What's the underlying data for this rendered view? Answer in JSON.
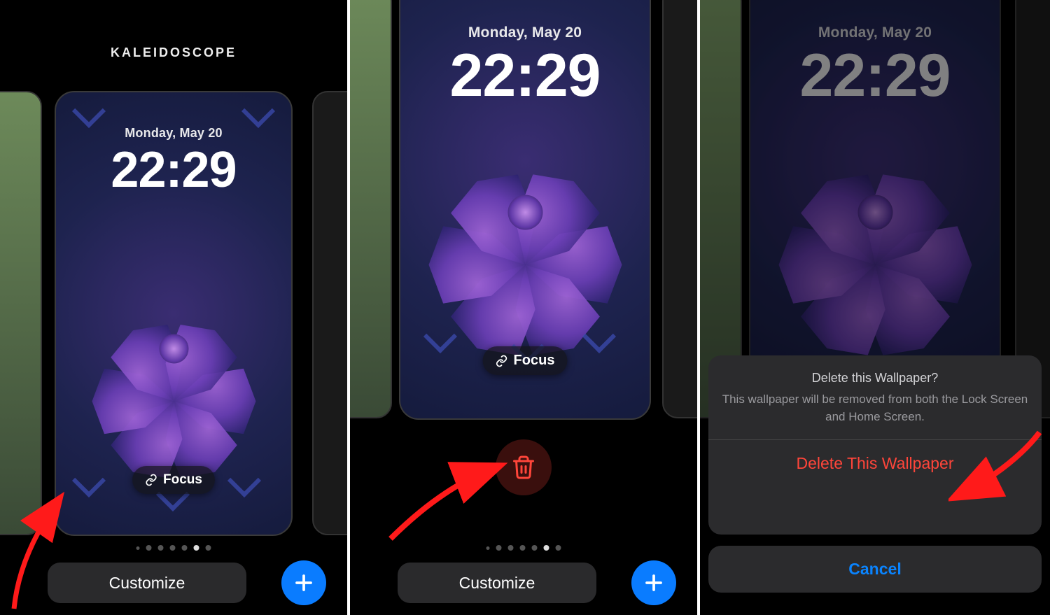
{
  "common": {
    "date_label": "Monday, May 20",
    "time_label": "22:29",
    "focus_label": "Focus",
    "customize_label": "Customize"
  },
  "panel1": {
    "title": "KALEIDOSCOPE",
    "dots_total": 7,
    "dots_active_index": 5
  },
  "panel2": {
    "dots_total": 7,
    "dots_active_index": 5
  },
  "panel3": {
    "sheet_title": "Delete this Wallpaper?",
    "sheet_subtitle": "This wallpaper will be removed from both the Lock Screen and Home Screen.",
    "delete_label": "Delete This Wallpaper",
    "cancel_label": "Cancel"
  },
  "colors": {
    "accent_blue": "#0a7cff",
    "danger_red": "#ff453a",
    "ios_blue": "#0a84ff"
  }
}
